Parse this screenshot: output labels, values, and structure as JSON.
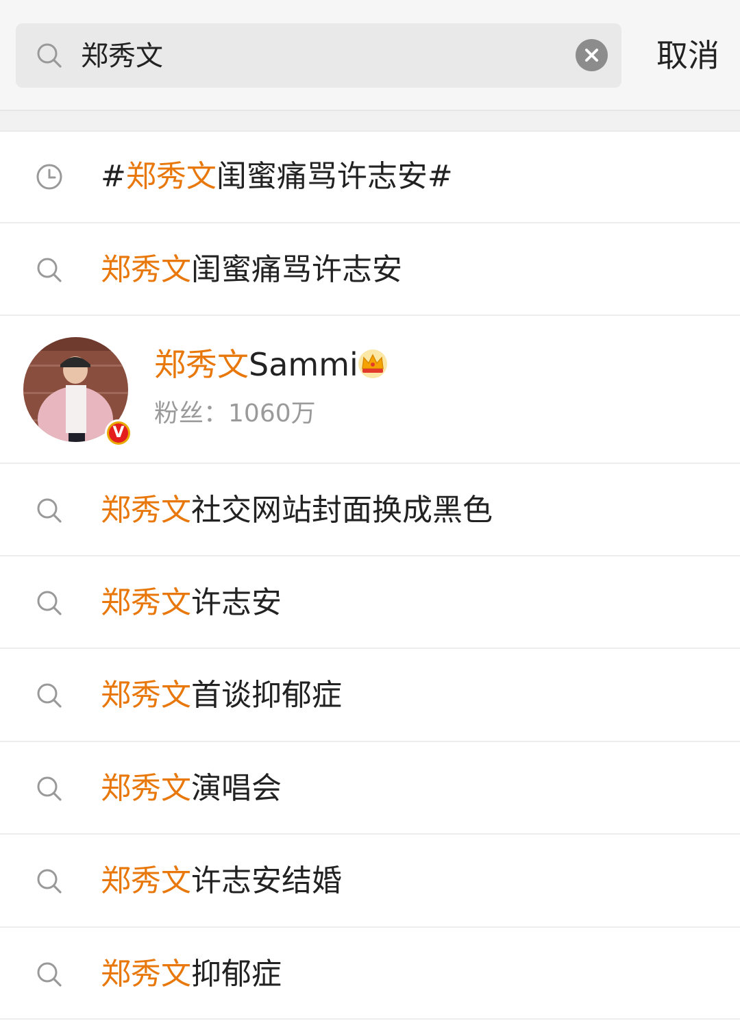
{
  "search": {
    "query": "郑秀文",
    "cancel_label": "取消"
  },
  "suggestions": [
    {
      "type": "history",
      "icon": "clock-icon",
      "prefix": "#",
      "highlight": "郑秀文",
      "rest": "闺蜜痛骂许志安#"
    },
    {
      "type": "search",
      "icon": "search-icon",
      "prefix": "",
      "highlight": "郑秀文",
      "rest": "闺蜜痛骂许志安"
    },
    {
      "type": "search",
      "icon": "search-icon",
      "prefix": "",
      "highlight": "郑秀文",
      "rest": "社交网站封面换成黑色"
    },
    {
      "type": "search",
      "icon": "search-icon",
      "prefix": "",
      "highlight": "郑秀文",
      "rest": "许志安"
    },
    {
      "type": "search",
      "icon": "search-icon",
      "prefix": "",
      "highlight": "郑秀文",
      "rest": "首谈抑郁症"
    },
    {
      "type": "search",
      "icon": "search-icon",
      "prefix": "",
      "highlight": "郑秀文",
      "rest": "演唱会"
    },
    {
      "type": "search",
      "icon": "search-icon",
      "prefix": "",
      "highlight": "郑秀文",
      "rest": "许志安结婚"
    },
    {
      "type": "search",
      "icon": "search-icon",
      "prefix": "",
      "highlight": "郑秀文",
      "rest": "抑郁症"
    }
  ],
  "user": {
    "name_highlight": "郑秀文",
    "name_rest": "Sammi",
    "fans_label": "粉丝：",
    "fans_count": "1060万",
    "badge_icon": "crown-icon",
    "verified_icon": "verified-v-icon",
    "verified_letter": "V"
  },
  "colors": {
    "highlight": "#e8780c",
    "text": "#222222",
    "secondary": "#9a9a9a"
  }
}
